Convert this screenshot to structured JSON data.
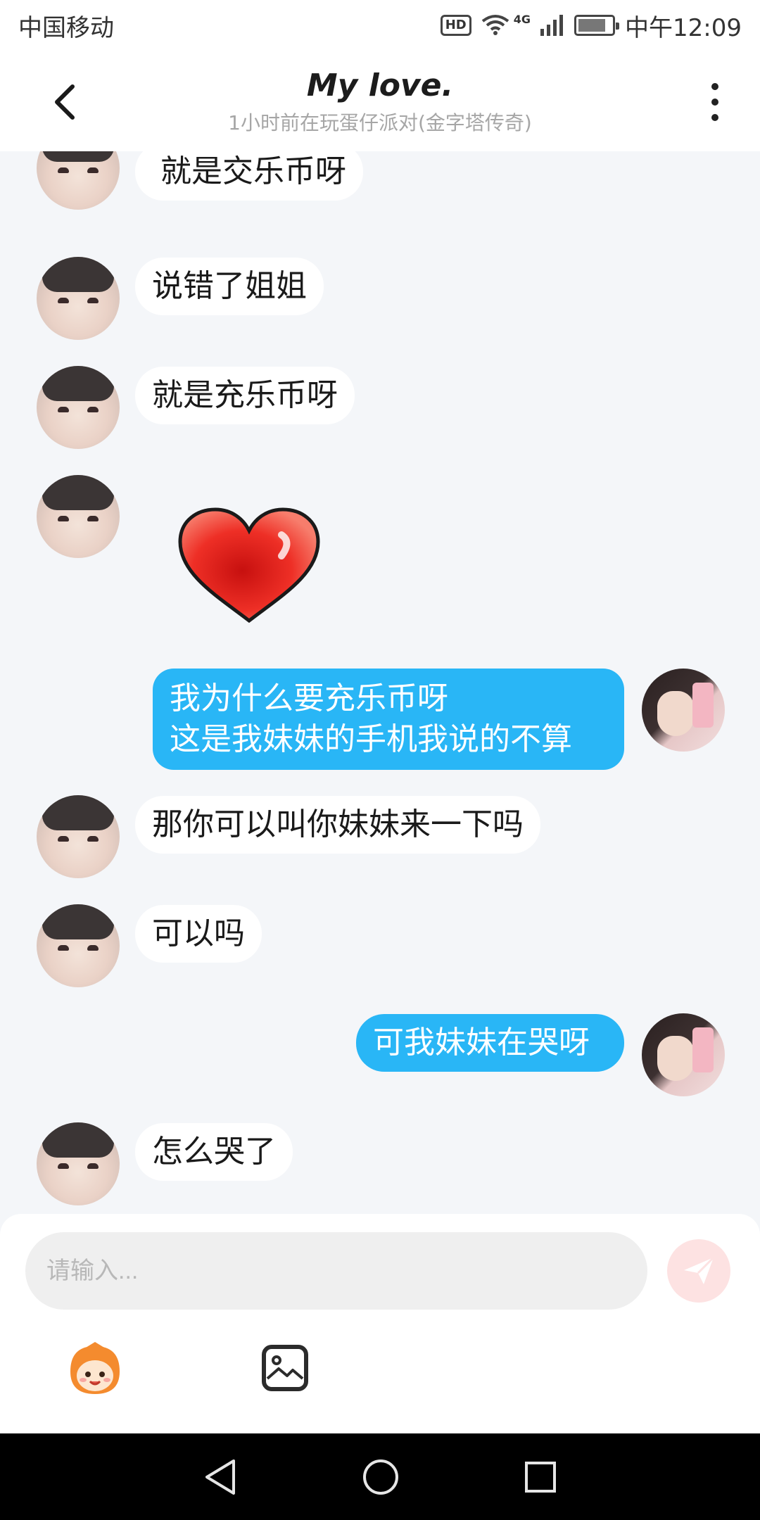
{
  "status_bar": {
    "carrier": "中国移动",
    "hd": "HD",
    "network": "4G",
    "time": "中午12:09"
  },
  "header": {
    "title": "My love",
    "title_dot": ".",
    "subtitle": "1小时前在玩蛋仔派对(金字塔传奇)"
  },
  "messages": [
    {
      "side": "in",
      "text": "就是交乐币呀"
    },
    {
      "side": "in",
      "text": "说错了姐姐"
    },
    {
      "side": "in",
      "text": "就是充乐币呀"
    },
    {
      "side": "in",
      "type": "sticker",
      "sticker": "red-heart"
    },
    {
      "side": "out",
      "line1": "我为什么要充乐币呀",
      "line2": "这是我妹妹的手机我说的不算"
    },
    {
      "side": "in",
      "text": "那你可以叫你妹妹来一下吗"
    },
    {
      "side": "in",
      "text": "可以吗"
    },
    {
      "side": "out",
      "text": "可我妹妹在哭呀"
    },
    {
      "side": "in",
      "text": "怎么哭了"
    }
  ],
  "composer": {
    "placeholder": "请输入...",
    "send_icon": "send-icon",
    "emoji_icon": "egg-party-emoji-icon",
    "image_icon": "image-icon"
  },
  "colors": {
    "accent": "#29b6f6",
    "send_disabled": "#fde2e2",
    "background": "#f4f6f9"
  }
}
